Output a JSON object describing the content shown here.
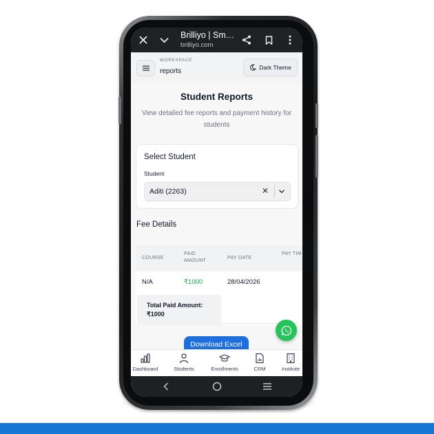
{
  "browser": {
    "title": "Brilliyo | Sm…",
    "url": "brilliyo.com",
    "close_icon": "close-icon",
    "collapse_icon": "chevron-down-icon",
    "share_icon": "share-icon",
    "bookmark_icon": "bookmark-icon",
    "more_icon": "more-vert-icon"
  },
  "header": {
    "workspace_label": "WORKSPACE",
    "workspace_value": "reports",
    "theme_button": "Dark Theme"
  },
  "page": {
    "title": "Student Reports",
    "subtitle": "View detailed fee reports and payment history for students"
  },
  "select_card": {
    "title": "Select Student",
    "field_label": "Student",
    "selected_value": "Aditi (2263)",
    "clear_glyph": "✕"
  },
  "fee": {
    "section_title": "Fee Details",
    "columns": [
      "COURSE",
      "PAID AMOUNT",
      "PAY DATE",
      "PAY TIM"
    ],
    "rows": [
      {
        "course": "N/A",
        "paid_amount": "₹1000",
        "pay_date": "28/04/2026"
      }
    ],
    "total_label": "Total Paid Amount:",
    "total_value": "₹1000"
  },
  "download_button": "Download Excel",
  "bottom_nav": [
    {
      "label": "Dashboard",
      "icon": "chart-icon"
    },
    {
      "label": "Students",
      "icon": "person-icon"
    },
    {
      "label": "Enrollments",
      "icon": "graduation-cap-icon"
    },
    {
      "label": "CRM",
      "icon": "document-chart-icon"
    },
    {
      "label": "Institute",
      "icon": "building-icon"
    }
  ],
  "colors": {
    "primary": "#1d6fe0",
    "whatsapp": "#25c35a",
    "paid_green": "#16a34a",
    "strip_blue": "#1877d2"
  }
}
